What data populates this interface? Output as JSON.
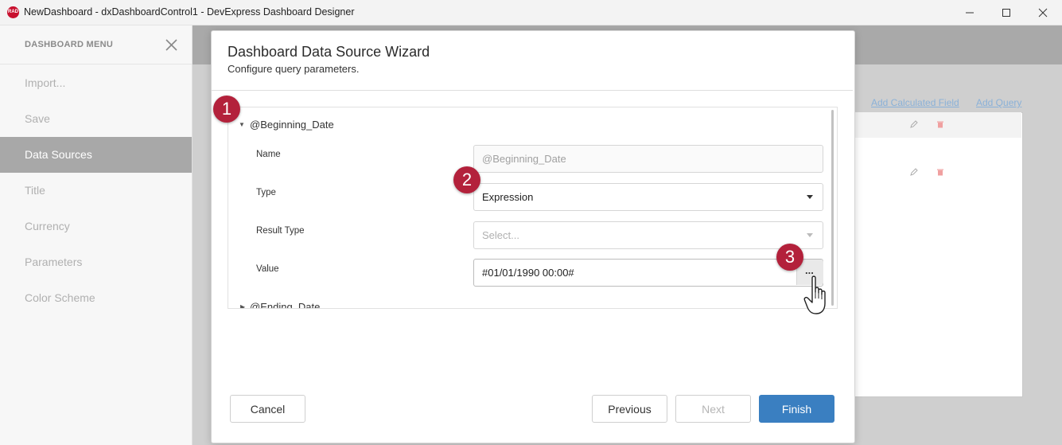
{
  "window": {
    "title": "NewDashboard - dxDashboardControl1 - DevExpress Dashboard Designer",
    "icon_label": "RAD",
    "controls": [
      "minimize-icon",
      "maximize-icon",
      "close-icon"
    ]
  },
  "sidebar": {
    "header": "DASHBOARD MENU",
    "items": [
      {
        "label": "Import...",
        "active": false
      },
      {
        "label": "Save",
        "active": false
      },
      {
        "label": "Data Sources",
        "active": true
      },
      {
        "label": "Title",
        "active": false
      },
      {
        "label": "Currency",
        "active": false
      },
      {
        "label": "Parameters",
        "active": false
      },
      {
        "label": "Color Scheme",
        "active": false
      }
    ]
  },
  "background": {
    "links": {
      "add_calculated_field": "Add Calculated Field",
      "add_query": "Add Query"
    },
    "icons": [
      "pencil-icon",
      "trash-icon"
    ]
  },
  "dialog": {
    "title": "Dashboard Data Source Wizard",
    "subtitle": "Configure query parameters.",
    "groups": [
      {
        "label": "@Beginning_Date",
        "expanded": true
      },
      {
        "label": "@Ending_Date",
        "expanded": false
      }
    ],
    "fields": {
      "name": {
        "label": "Name",
        "value": "@Beginning_Date"
      },
      "type": {
        "label": "Type",
        "value": "Expression"
      },
      "result_type": {
        "label": "Result Type",
        "placeholder": "Select..."
      },
      "value": {
        "label": "Value",
        "value": "#01/01/1990 00:00#",
        "button": "..."
      }
    },
    "buttons": {
      "cancel": "Cancel",
      "previous": "Previous",
      "next": "Next",
      "finish": "Finish"
    }
  },
  "badges": [
    "1",
    "2",
    "3"
  ],
  "colors": {
    "accent": "#3a7fc1",
    "badge": "#b3213b",
    "active_menu": "#a8a8a8"
  }
}
